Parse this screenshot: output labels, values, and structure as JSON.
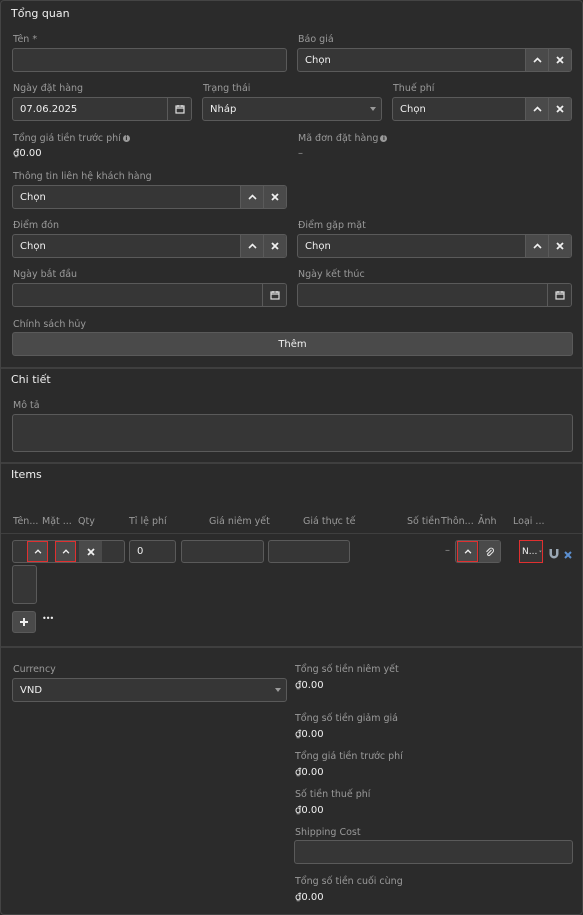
{
  "overview": {
    "title": "Tổng quan",
    "name_label": "Tên *",
    "name_value": "",
    "quote_label": "Báo giá",
    "quote_value": "Chọn",
    "order_date_label": "Ngày đặt hàng",
    "order_date_value": "07.06.2025",
    "status_label": "Trạng thái",
    "status_value": "Nháp",
    "tax_label": "Thuế phí",
    "tax_value": "Chọn",
    "pretax_label": "Tổng giá tiền trước phí",
    "pretax_value": "₫0.00",
    "order_code_label": "Mã đơn đặt hàng",
    "order_code_value": "–",
    "contact_label": "Thông tin liên hệ khách hàng",
    "contact_value": "Chọn",
    "pickup_label": "Điểm đón",
    "pickup_value": "Chọn",
    "meeting_label": "Điểm gặp mặt",
    "meeting_value": "Chọn",
    "start_label": "Ngày bắt đầu",
    "end_label": "Ngày kết thúc",
    "cancel_label": "Chính sách hủy",
    "add_label": "Thêm"
  },
  "details": {
    "title": "Chi tiết",
    "desc_label": "Mô tả"
  },
  "items": {
    "title": "Items",
    "columns": [
      "Tên...",
      "Mặt ...",
      "Qty",
      "Tỉ lệ phí",
      "Giá niêm yết",
      "Giá thực tế",
      "Số tiền",
      "Thôn...",
      "Ảnh",
      "Loại ..."
    ],
    "row": {
      "rate_value": "0",
      "amount_value": "–",
      "type_value": "N..."
    },
    "more_label": "•••"
  },
  "totals": {
    "currency_label": "Currency",
    "currency_value": "VND",
    "list_total_label": "Tổng số tiền niêm yết",
    "list_total_value": "₫0.00",
    "discount_label": "Tổng số tiền giảm giá",
    "discount_value": "₫0.00",
    "pretax_label": "Tổng giá tiền trước phí",
    "pretax_value": "₫0.00",
    "tax_label": "Số tiền thuế phí",
    "tax_value": "₫0.00",
    "shipping_label": "Shipping Cost",
    "shipping_value": "",
    "final_label": "Tổng số tiền cuối cùng",
    "final_value": "₫0.00"
  }
}
